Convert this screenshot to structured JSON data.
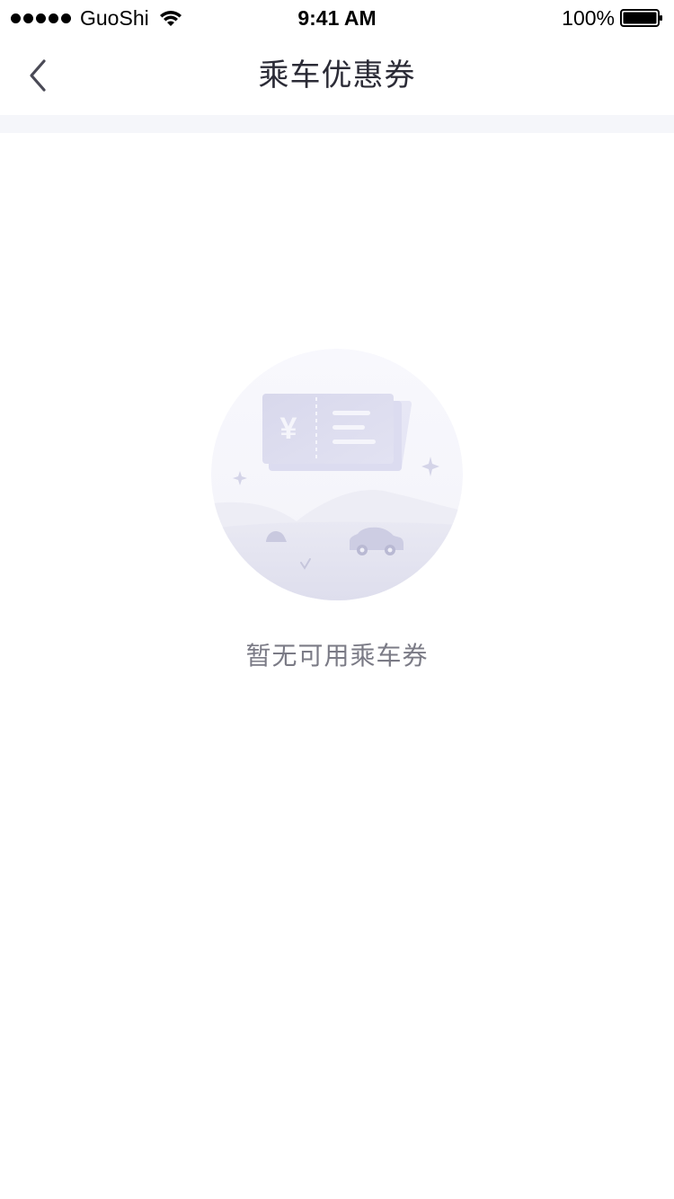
{
  "status_bar": {
    "carrier": "GuoShi",
    "time": "9:41 AM",
    "battery": "100%",
    "signal_icon": "signal-dots-icon",
    "wifi_icon": "wifi-icon",
    "battery_icon": "battery-icon"
  },
  "nav": {
    "title": "乘车优惠券",
    "back_icon": "chevron-left-icon"
  },
  "empty_state": {
    "message": "暂无可用乘车券",
    "illustration": "coupon-empty-illustration",
    "currency_symbol": "¥"
  },
  "colors": {
    "background": "#ffffff",
    "divider": "#f5f6fa",
    "title_text": "#2b2b36",
    "secondary_text": "#7b7b86",
    "illustration_base": "#dcdcee"
  }
}
